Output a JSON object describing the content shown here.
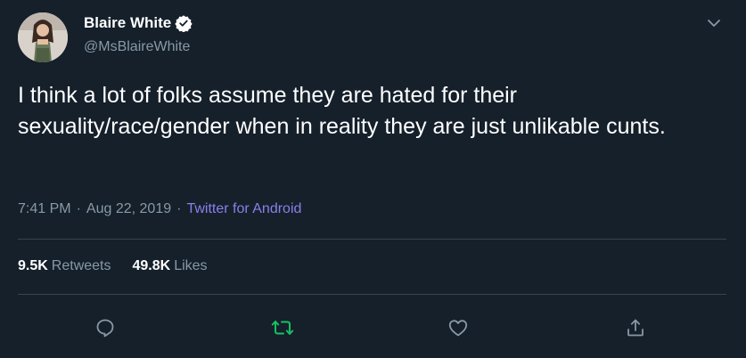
{
  "author": {
    "display_name": "Blaire White",
    "handle": "@MsBlaireWhite",
    "verified": true
  },
  "tweet": {
    "text": "I think a lot of folks assume they are hated for their sexuality/race/gender when in reality they are just unlikable cunts.",
    "time": "7:41 PM",
    "separator": "·",
    "date": "Aug 22, 2019",
    "source": "Twitter for Android"
  },
  "stats": {
    "retweets_count": "9.5K",
    "retweets_label": "Retweets",
    "likes_count": "49.8K",
    "likes_label": "Likes"
  },
  "icons": {
    "reply": "reply-icon",
    "retweet": "retweet-icon",
    "like": "like-icon",
    "share": "share-icon",
    "menu": "chevron-down-icon",
    "verified": "verified-badge-icon"
  },
  "colors": {
    "background": "#15202b",
    "text": "#ffffff",
    "muted": "#8899a6",
    "source_link": "#8b7fe8",
    "retweet_active": "#17bf63",
    "divider": "#38444d",
    "verified": "#1da1f2"
  }
}
